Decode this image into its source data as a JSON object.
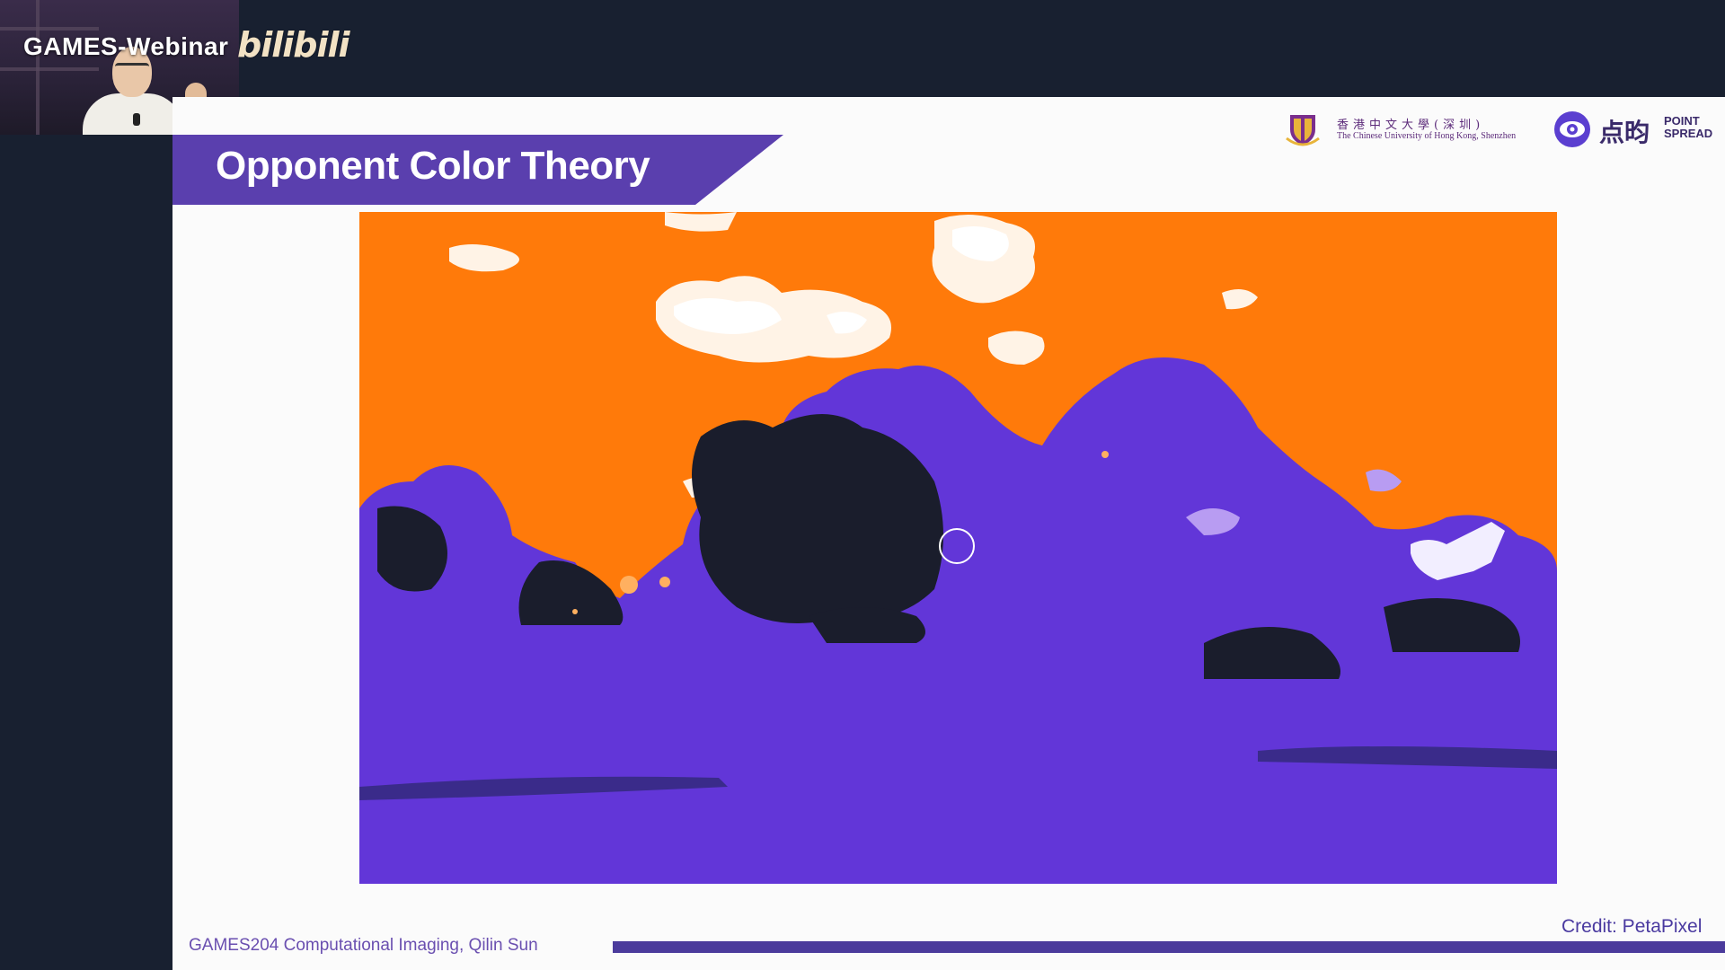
{
  "webcam": {
    "channel_title": "GAMES-Webinar",
    "platform_logo": "bilibili"
  },
  "slide": {
    "title": "Opponent Color Theory",
    "logos": {
      "cuhk_chinese": "香港中文大學(深圳)",
      "cuhk_english": "The Chinese University of Hong Kong, Shenzhen",
      "pointspread_chinese": "点昀",
      "pointspread_english_line1": "POINT",
      "pointspread_english_line2": "SPREAD"
    },
    "image_credit": "Credit: PetaPixel",
    "footer": "GAMES204 Computational Imaging, Qilin Sun"
  },
  "colors": {
    "banner": "#5a3fae",
    "photo_sky": "#ff7a0a",
    "photo_foliage": "#6236d8",
    "photo_dark": "#1a1d2c",
    "footer_bar": "#4b3b9c"
  },
  "icons": {
    "cursor": "circle-cursor-icon",
    "cuhk": "cuhk-crest-icon",
    "pointspread": "pointspread-eye-icon"
  }
}
